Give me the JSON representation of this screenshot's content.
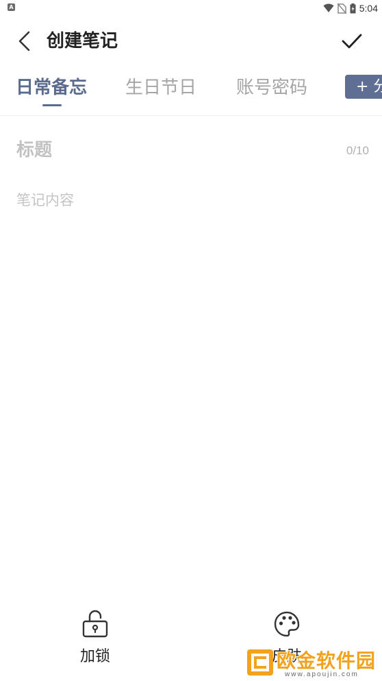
{
  "status_bar": {
    "notification_icon": "A",
    "time": "5:04",
    "icons": [
      "wifi-icon",
      "no-sim-icon",
      "battery-icon"
    ]
  },
  "header": {
    "title": "创建笔记",
    "back_icon": "chevron-left-icon",
    "confirm_icon": "check-icon"
  },
  "tabs": [
    {
      "label": "日常备忘",
      "active": true
    },
    {
      "label": "生日节日",
      "active": false
    },
    {
      "label": "账号密码",
      "active": false
    }
  ],
  "add_category_label": "+ 分",
  "editor": {
    "title_placeholder": "标题",
    "title_value": "",
    "title_counter": "0/10",
    "content_placeholder": "笔记内容",
    "content_value": ""
  },
  "toolbar": {
    "lock_label": "加锁",
    "skin_label": "皮肤"
  },
  "watermark": {
    "text": "欧金软件园",
    "url": "www.apoujin.com"
  },
  "colors": {
    "accent": "#5a6b8e",
    "tab_inactive": "#a5a5a5",
    "placeholder": "#c2c2c2",
    "watermark": "#f2a21b"
  }
}
